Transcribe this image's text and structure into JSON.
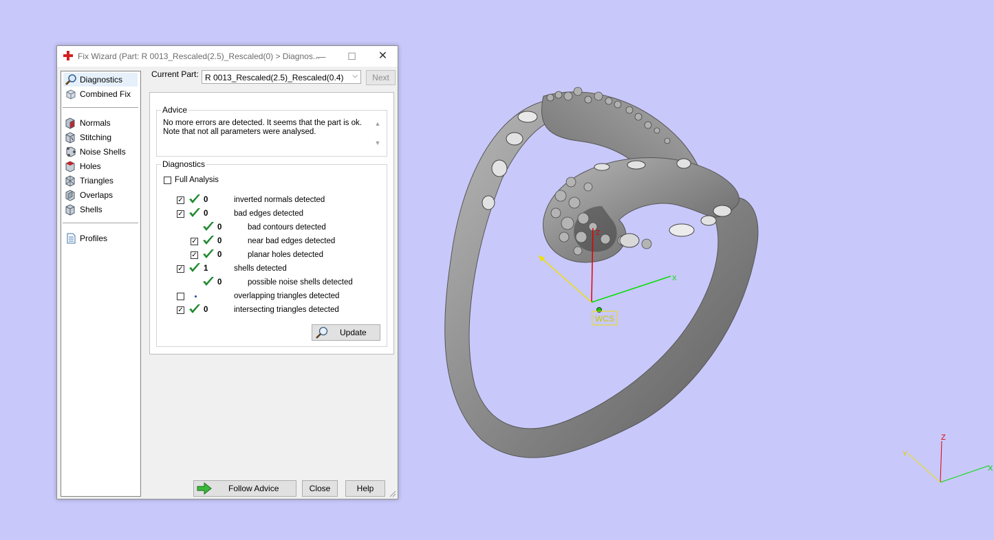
{
  "window": {
    "title": "Fix Wizard (Part: R 0013_Rescaled(2.5)_Rescaled(0) > Diagnos...",
    "minimize": "—",
    "maximize": "☐",
    "close": "✕"
  },
  "nav": {
    "items": [
      {
        "label": "Diagnostics",
        "icon": "magnifier-icon",
        "selected": true
      },
      {
        "label": "Combined Fix",
        "icon": "combined-fix-icon"
      },
      {
        "label": "Normals",
        "icon": "normals-icon"
      },
      {
        "label": "Stitching",
        "icon": "stitching-icon"
      },
      {
        "label": "Noise Shells",
        "icon": "noise-shells-icon"
      },
      {
        "label": "Holes",
        "icon": "holes-icon"
      },
      {
        "label": "Triangles",
        "icon": "triangles-icon"
      },
      {
        "label": "Overlaps",
        "icon": "overlaps-icon"
      },
      {
        "label": "Shells",
        "icon": "shells-icon"
      },
      {
        "label": "Profiles",
        "icon": "profiles-icon"
      }
    ]
  },
  "current_part": {
    "label": "Current Part:",
    "value": "R 0013_Rescaled(2.5)_Rescaled(0.4)",
    "next_label": "Next"
  },
  "advice": {
    "title": "Advice",
    "text": "No more errors are detected. It seems that the part is ok.\nNote that not all parameters were analysed."
  },
  "diagnostics": {
    "title": "Diagnostics",
    "full_analysis_label": "Full Analysis",
    "full_analysis_checked": false,
    "rows": [
      {
        "checkbox": true,
        "checked": true,
        "status": "ok",
        "count": "0",
        "label": "inverted normals detected",
        "indent": 0
      },
      {
        "checkbox": true,
        "checked": true,
        "status": "ok",
        "count": "0",
        "label": "bad edges detected",
        "indent": 0
      },
      {
        "checkbox": false,
        "checked": false,
        "status": "ok",
        "count": "0",
        "label": "bad contours detected",
        "indent": 1
      },
      {
        "checkbox": true,
        "checked": true,
        "status": "ok",
        "count": "0",
        "label": "near bad edges detected",
        "indent": 1
      },
      {
        "checkbox": true,
        "checked": true,
        "status": "ok",
        "count": "0",
        "label": "planar holes detected",
        "indent": 1
      },
      {
        "checkbox": true,
        "checked": true,
        "status": "ok",
        "count": "1",
        "label": "shells detected",
        "indent": 0
      },
      {
        "checkbox": false,
        "checked": false,
        "status": "ok",
        "count": "0",
        "label": "possible noise shells detected",
        "indent": 1
      },
      {
        "checkbox": true,
        "checked": false,
        "status": "not-analysed",
        "count": "",
        "label": "overlapping triangles detected",
        "indent": 0
      },
      {
        "checkbox": true,
        "checked": true,
        "status": "ok",
        "count": "0",
        "label": "intersecting triangles detected",
        "indent": 0
      }
    ],
    "update_label": "Update"
  },
  "footer": {
    "follow_advice_label": "Follow Advice",
    "close_label": "Close",
    "help_label": "Help"
  },
  "viewport": {
    "wcs_label": "WCS",
    "axis_x": "X",
    "axis_y": "Y",
    "axis_z": "Z",
    "background": "#c8c8fa",
    "model_color": "#8a8a8a"
  }
}
